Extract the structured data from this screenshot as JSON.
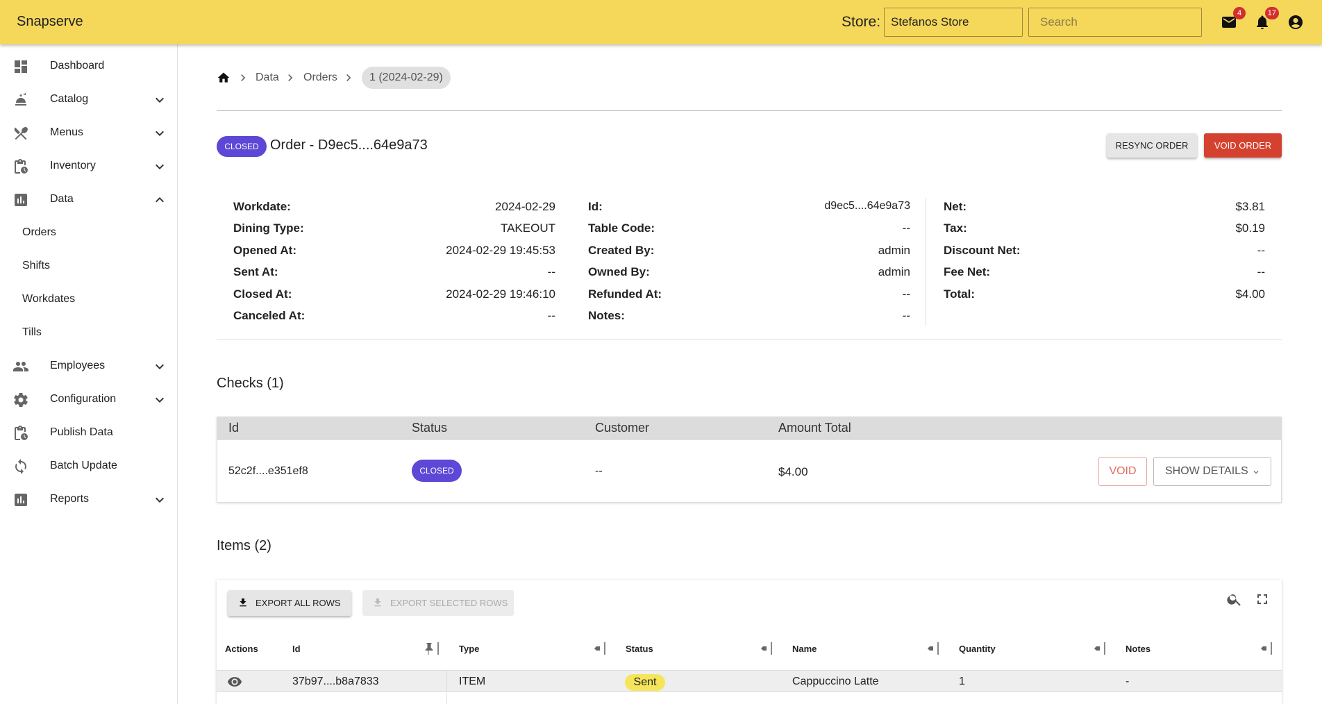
{
  "app": {
    "brand": "Snapserve"
  },
  "header": {
    "store_label": "Store:",
    "store_value": "Stefanos Store",
    "search_placeholder": "Search",
    "mail_badge": "4",
    "notif_badge": "17"
  },
  "sidebar": {
    "items": [
      {
        "label": "Dashboard",
        "icon": "dashboard-icon"
      },
      {
        "label": "Catalog",
        "icon": "catalog-icon"
      },
      {
        "label": "Menus",
        "icon": "utensils-icon"
      },
      {
        "label": "Inventory",
        "icon": "clipboard-icon"
      },
      {
        "label": "Data",
        "icon": "bar-chart-icon"
      },
      {
        "label": "Orders"
      },
      {
        "label": "Shifts"
      },
      {
        "label": "Workdates"
      },
      {
        "label": "Tills"
      },
      {
        "label": "Employees",
        "icon": "people-icon"
      },
      {
        "label": "Configuration",
        "icon": "gear-icon"
      },
      {
        "label": "Publish Data",
        "icon": "clipboard-icon"
      },
      {
        "label": "Batch Update",
        "icon": "sync-icon"
      },
      {
        "label": "Reports",
        "icon": "bar-chart-icon"
      }
    ]
  },
  "breadcrumb": {
    "items": [
      "Data",
      "Orders"
    ],
    "current": "1 (2024-02-29)"
  },
  "order": {
    "status": "CLOSED",
    "title": "Order - D9ec5....64e9a73",
    "resync_label": "RESYNC ORDER",
    "void_label": "VOID ORDER"
  },
  "details": {
    "col1": [
      {
        "label": "Workdate:",
        "value": "2024-02-29"
      },
      {
        "label": "Dining Type:",
        "value": "TAKEOUT"
      },
      {
        "label": "Opened At:",
        "value": "2024-02-29 19:45:53"
      },
      {
        "label": "Sent At:",
        "value": "--"
      },
      {
        "label": "Closed At:",
        "value": "2024-02-29 19:46:10"
      },
      {
        "label": "Canceled At:",
        "value": "--"
      }
    ],
    "col2": [
      {
        "label": "Id:",
        "value": "d9ec5....64e9a73"
      },
      {
        "label": "Table Code:",
        "value": "--"
      },
      {
        "label": "Created By:",
        "value": "admin"
      },
      {
        "label": "Owned By:",
        "value": "admin"
      },
      {
        "label": "Refunded At:",
        "value": "--"
      },
      {
        "label": "Notes:",
        "value": "--"
      }
    ],
    "col3": [
      {
        "label": "Net:",
        "value": "$3.81"
      },
      {
        "label": "Tax:",
        "value": "$0.19"
      },
      {
        "label": "Discount Net:",
        "value": "--"
      },
      {
        "label": "Fee Net:",
        "value": "--"
      },
      {
        "label": "Total:",
        "value": "$4.00"
      }
    ]
  },
  "checks": {
    "title": "Checks (1)",
    "columns": [
      "Id",
      "Status",
      "Customer",
      "Amount Total"
    ],
    "rows": [
      {
        "id": "52c2f....e351ef8",
        "status": "CLOSED",
        "customer": "--",
        "amount": "$4.00"
      }
    ],
    "void_label": "VOID",
    "details_label": "SHOW DETAILS"
  },
  "items": {
    "title": "Items (2)",
    "export_all_label": "EXPORT ALL ROWS",
    "export_selected_label": "EXPORT SELECTED ROWS",
    "columns": [
      "Actions",
      "Id",
      "Type",
      "Status",
      "Name",
      "Quantity",
      "Notes"
    ],
    "rows": [
      {
        "id": "37b97....b8a7833",
        "type": "ITEM",
        "status": "Sent",
        "name": "Cappuccino Latte",
        "quantity": "1",
        "notes": "-"
      }
    ]
  },
  "colors": {
    "topbar": "#f5d75a",
    "closed_chip": "#5c47d6",
    "void_button": "#d4422f",
    "sent_chip": "#f5e55a"
  }
}
